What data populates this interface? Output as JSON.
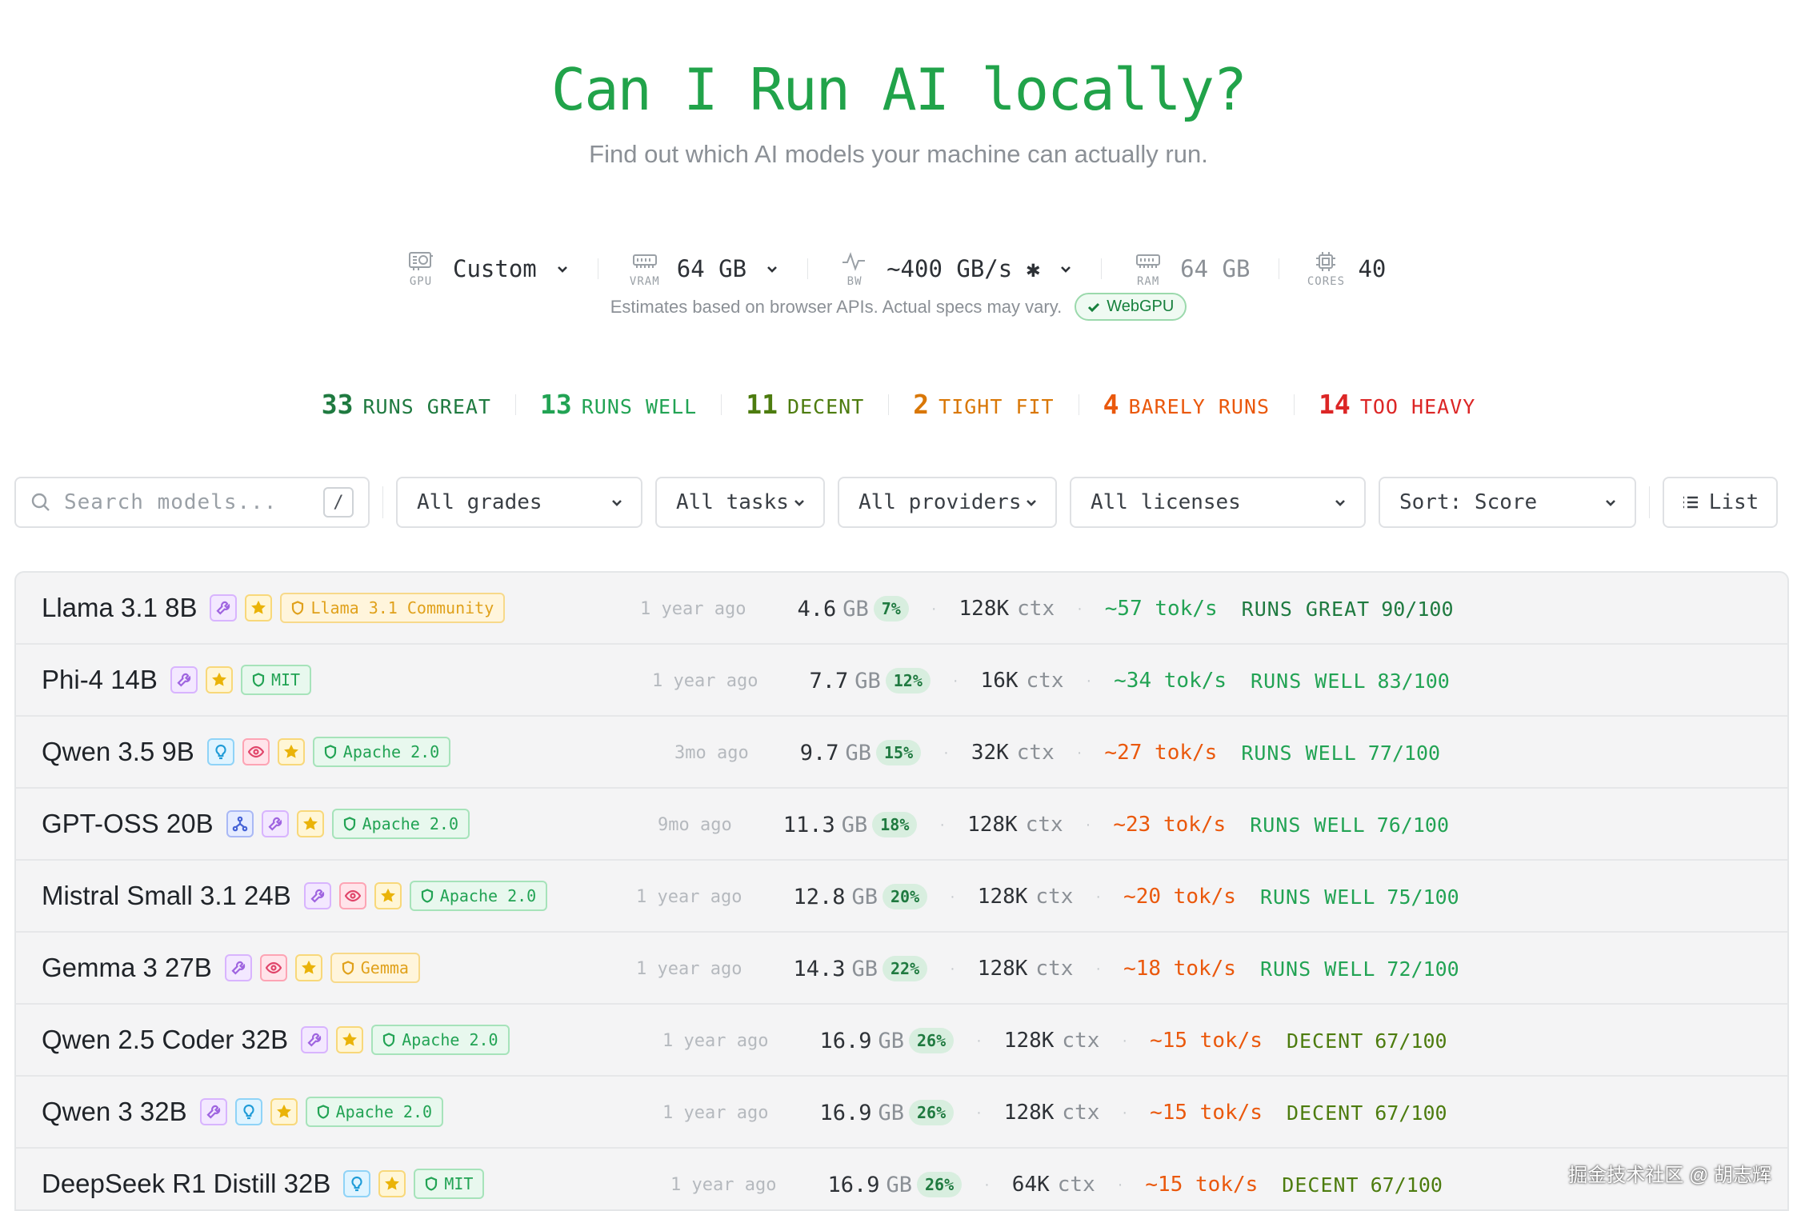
{
  "header": {
    "title": "Can I Run AI locally?",
    "subtitle": "Find out which AI models your machine can actually run."
  },
  "hardware": {
    "gpu": {
      "label": "GPU",
      "value": "Custom",
      "icon": "gpu-icon"
    },
    "vram": {
      "label": "VRAM",
      "value": "64 GB",
      "icon": "memory-icon"
    },
    "bandwidth": {
      "label": "BW",
      "value": "~400 GB/s ✱",
      "icon": "activity-icon"
    },
    "ram": {
      "label": "RAM",
      "value": "64 GB",
      "icon": "memory-icon"
    },
    "cores": {
      "label": "CORES",
      "value": "40",
      "icon": "cpu-icon"
    },
    "note": "Estimates based on browser APIs. Actual specs may vary.",
    "webgpu_badge": "WebGPU"
  },
  "grade_summary": [
    {
      "count": "33",
      "label": "RUNS GREAT",
      "color": "#1f7a40"
    },
    {
      "count": "13",
      "label": "RUNS WELL",
      "color": "#22a354"
    },
    {
      "count": "11",
      "label": "DECENT",
      "color": "#4d7c0f"
    },
    {
      "count": "2",
      "label": "TIGHT FIT",
      "color": "#d97706"
    },
    {
      "count": "4",
      "label": "BARELY RUNS",
      "color": "#ea580c"
    },
    {
      "count": "14",
      "label": "TOO HEAVY",
      "color": "#dc2626"
    }
  ],
  "filters": {
    "search_placeholder": "Search models...",
    "search_shortcut": "/",
    "grades": "All grades",
    "tasks": "All tasks",
    "providers": "All providers",
    "licenses": "All licenses",
    "sort": "Sort: Score",
    "view": "List"
  },
  "size_unit": "GB",
  "ctx_unit": "ctx",
  "models": [
    {
      "name": "Llama 3.1 8B",
      "tags": [
        "tool",
        "star"
      ],
      "license": "Llama 3.1 Community",
      "license_color": "amber",
      "date": "1 year ago",
      "size": "4.6",
      "pct": "7%",
      "ctx": "128K",
      "tps": "~57 tok/s",
      "tps_color": "#22a354",
      "verdict": "RUNS GREAT",
      "score": "90/100",
      "verdict_color": "#1f7a40"
    },
    {
      "name": "Phi-4 14B",
      "tags": [
        "tool",
        "star"
      ],
      "license": "MIT",
      "license_color": "green",
      "date": "1 year ago",
      "size": "7.7",
      "pct": "12%",
      "ctx": "16K",
      "tps": "~34 tok/s",
      "tps_color": "#22a354",
      "verdict": "RUNS WELL",
      "score": "83/100",
      "verdict_color": "#22a354"
    },
    {
      "name": "Qwen 3.5 9B",
      "tags": [
        "reason",
        "vision",
        "star"
      ],
      "license": "Apache 2.0",
      "license_color": "green",
      "date": "3mo ago",
      "size": "9.7",
      "pct": "15%",
      "ctx": "32K",
      "tps": "~27 tok/s",
      "tps_color": "#ea580c",
      "verdict": "RUNS WELL",
      "score": "77/100",
      "verdict_color": "#22a354"
    },
    {
      "name": "GPT-OSS 20B",
      "tags": [
        "moe",
        "tool",
        "star"
      ],
      "license": "Apache 2.0",
      "license_color": "green",
      "date": "9mo ago",
      "size": "11.3",
      "pct": "18%",
      "ctx": "128K",
      "tps": "~23 tok/s",
      "tps_color": "#ea580c",
      "verdict": "RUNS WELL",
      "score": "76/100",
      "verdict_color": "#22a354"
    },
    {
      "name": "Mistral Small 3.1 24B",
      "tags": [
        "tool",
        "vision",
        "star"
      ],
      "license": "Apache 2.0",
      "license_color": "green",
      "date": "1 year ago",
      "size": "12.8",
      "pct": "20%",
      "ctx": "128K",
      "tps": "~20 tok/s",
      "tps_color": "#ea580c",
      "verdict": "RUNS WELL",
      "score": "75/100",
      "verdict_color": "#22a354"
    },
    {
      "name": "Gemma 3 27B",
      "tags": [
        "tool",
        "vision",
        "star"
      ],
      "license": "Gemma",
      "license_color": "amber",
      "date": "1 year ago",
      "size": "14.3",
      "pct": "22%",
      "ctx": "128K",
      "tps": "~18 tok/s",
      "tps_color": "#ea580c",
      "verdict": "RUNS WELL",
      "score": "72/100",
      "verdict_color": "#22a354"
    },
    {
      "name": "Qwen 2.5 Coder 32B",
      "tags": [
        "tool",
        "star"
      ],
      "license": "Apache 2.0",
      "license_color": "green",
      "date": "1 year ago",
      "size": "16.9",
      "pct": "26%",
      "ctx": "128K",
      "tps": "~15 tok/s",
      "tps_color": "#ea580c",
      "verdict": "DECENT",
      "score": "67/100",
      "verdict_color": "#4d7c0f"
    },
    {
      "name": "Qwen 3 32B",
      "tags": [
        "tool",
        "reason",
        "star"
      ],
      "license": "Apache 2.0",
      "license_color": "green",
      "date": "1 year ago",
      "size": "16.9",
      "pct": "26%",
      "ctx": "128K",
      "tps": "~15 tok/s",
      "tps_color": "#ea580c",
      "verdict": "DECENT",
      "score": "67/100",
      "verdict_color": "#4d7c0f"
    },
    {
      "name": "DeepSeek R1 Distill 32B",
      "tags": [
        "reason",
        "star"
      ],
      "license": "MIT",
      "license_color": "green",
      "date": "1 year ago",
      "size": "16.9",
      "pct": "26%",
      "ctx": "64K",
      "tps": "~15 tok/s",
      "tps_color": "#ea580c",
      "verdict": "DECENT",
      "score": "67/100",
      "verdict_color": "#4d7c0f"
    }
  ],
  "watermark": "掘金技术社区 @ 胡志辉"
}
